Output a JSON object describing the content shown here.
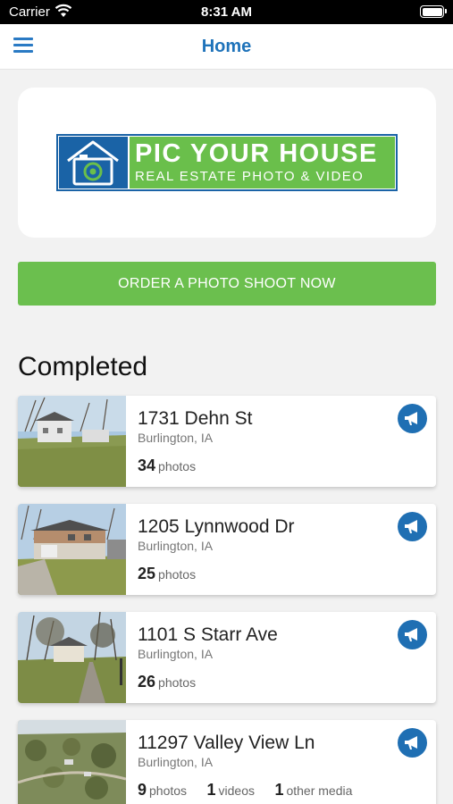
{
  "status_bar": {
    "carrier": "Carrier",
    "time": "8:31 AM"
  },
  "nav": {
    "title": "Home"
  },
  "logo": {
    "name": "PIC YOUR HOUSE",
    "tagline": "REAL ESTATE PHOTO & VIDEO"
  },
  "order_button": {
    "label": "ORDER A PHOTO SHOOT NOW"
  },
  "section": {
    "title": "Completed"
  },
  "colors": {
    "accent": "#1f73ba",
    "green": "#6bbf4e",
    "share": "#1f6fb3"
  },
  "listings": [
    {
      "address": "1731 Dehn St",
      "city": "Burlington, IA",
      "photos_count": "34",
      "photos_label": "photos"
    },
    {
      "address": "1205 Lynnwood Dr",
      "city": "Burlington, IA",
      "photos_count": "25",
      "photos_label": "photos"
    },
    {
      "address": "1101 S Starr Ave",
      "city": "Burlington, IA",
      "photos_count": "26",
      "photos_label": "photos"
    },
    {
      "address": "11297 Valley View Ln",
      "city": "Burlington, IA",
      "photos_count": "9",
      "photos_label": "photos",
      "videos_count": "1",
      "videos_label": "videos",
      "other_count": "1",
      "other_label": "other media"
    }
  ]
}
